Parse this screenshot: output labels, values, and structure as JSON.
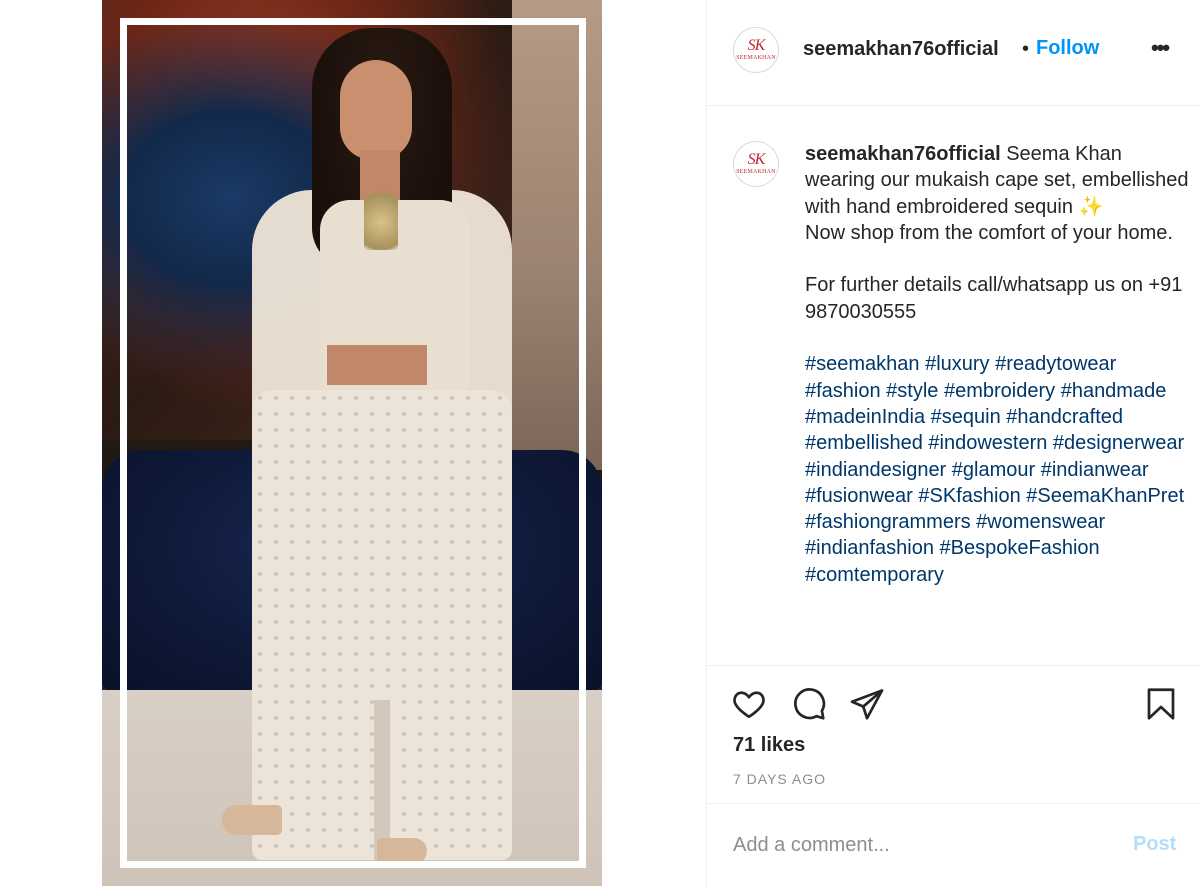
{
  "post": {
    "username": "seemakhan76official",
    "separator": "•",
    "follow_label": "Follow",
    "more_label": "•••",
    "avatar_monogram": "SK",
    "avatar_brand": "SEEMAKHAN"
  },
  "caption": {
    "username": "seemakhan76official",
    "text_line1": "Seema Khan wearing our mukaish cape set, embellished with hand embroidered sequin ✨",
    "text_line2": "Now shop from the comfort of your home.",
    "text_line3": "For further details call/whatsapp us on +91 9870030555",
    "hashtags": "#seemakhan #luxury #readytowear #fashion #style #embroidery #handmade #madeinIndia #sequin #handcrafted #embellished #indowestern #designerwear #indiandesigner #glamour #indianwear #fusionwear #SKfashion #SeemaKhanPret #fashiongrammers #womenswear #indianfashion #BespokeFashion #comtemporary"
  },
  "actions": {
    "icons": [
      "heart-icon",
      "comment-icon",
      "share-icon",
      "bookmark-icon"
    ],
    "likes": "71 likes",
    "timestamp": "7 DAYS AGO"
  },
  "comment": {
    "placeholder": "Add a comment...",
    "post_label": "Post"
  },
  "colors": {
    "accent": "#0095f6",
    "post_disabled": "#b2dffc",
    "hashtag": "#00376b",
    "brand_red": "#c2262e",
    "muted": "#8e8e8e"
  }
}
